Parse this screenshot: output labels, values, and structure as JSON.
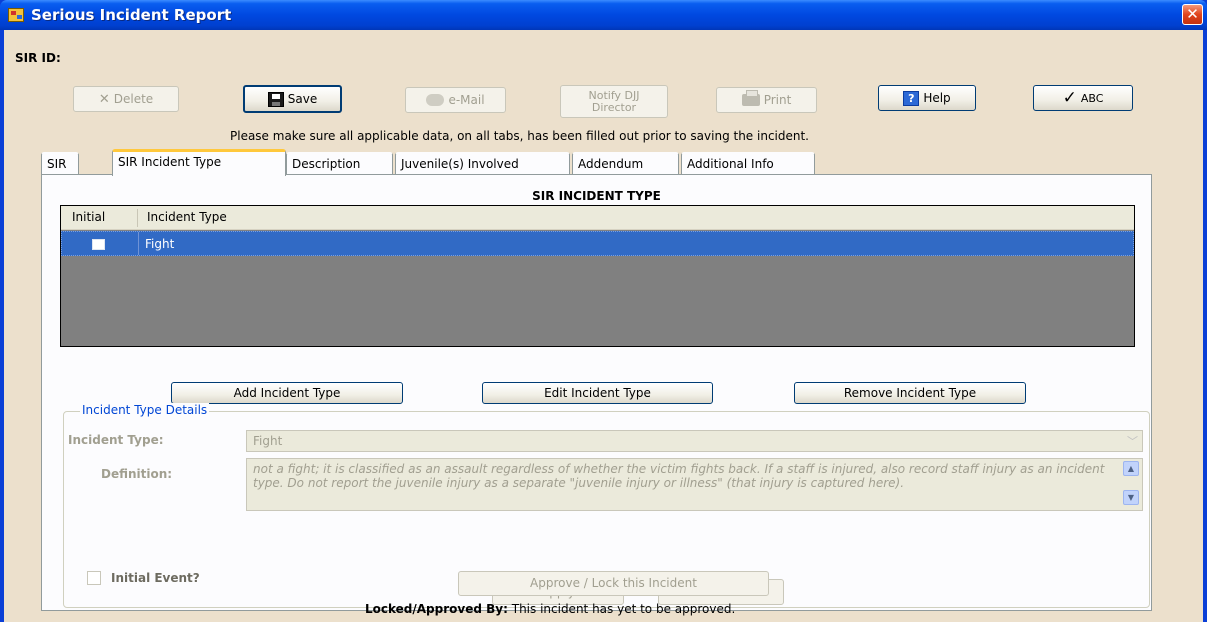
{
  "window": {
    "title": "Serious Incident Report",
    "close_glyph": "✕"
  },
  "header": {
    "sir_id_label": "SIR ID:"
  },
  "toolbar": {
    "delete_label": "Delete",
    "save_label": "Save",
    "email_label": "e-Mail",
    "notify_line1": "Notify DJJ",
    "notify_line2": "Director",
    "print_label": "Print",
    "help_label": "Help",
    "spell_label": "ABC"
  },
  "notice": "Please make sure all applicable data, on all tabs, has been filled out prior to saving the incident.",
  "tabs": [
    {
      "label": "SIR"
    },
    {
      "label": "SIR Incident Type"
    },
    {
      "label": "Description"
    },
    {
      "label": "Juvenile(s) Involved"
    },
    {
      "label": "Addendum"
    },
    {
      "label": "Additional Info"
    }
  ],
  "panel": {
    "title": "SIR INCIDENT TYPE",
    "grid": {
      "columns": [
        "Initial",
        "Incident Type"
      ],
      "rows": [
        {
          "initial": false,
          "incident_type": "Fight"
        }
      ]
    },
    "buttons": {
      "add": "Add Incident Type",
      "edit": "Edit Incident Type",
      "remove": "Remove Incident Type"
    },
    "details": {
      "legend": "Incident Type Details",
      "incident_type_label": "Incident Type:",
      "incident_type_value": "Fight",
      "definition_label": "Definition:",
      "definition_text": "not a fight; it is classified as an assault regardless of whether the victim fights back. If a staff is injured, also record staff injury as an incident type. Do not report the juvenile injury as a separate \"juvenile injury or illness\" (that injury is captured here).",
      "initial_event_label": "Initial Event?",
      "apply_label": "Apply",
      "cancel_label": "Cancel"
    }
  },
  "footer": {
    "approve_label": "Approve / Lock this Incident",
    "locked_by_label": "Locked/Approved By:",
    "locked_by_value": "This incident has yet to be approved."
  },
  "colors": {
    "titlebar": "#0048e0",
    "client_bg": "#ece0cc",
    "selection": "#316ac5",
    "legend_blue": "#0046d5",
    "disabled_text": "#a19f90"
  }
}
